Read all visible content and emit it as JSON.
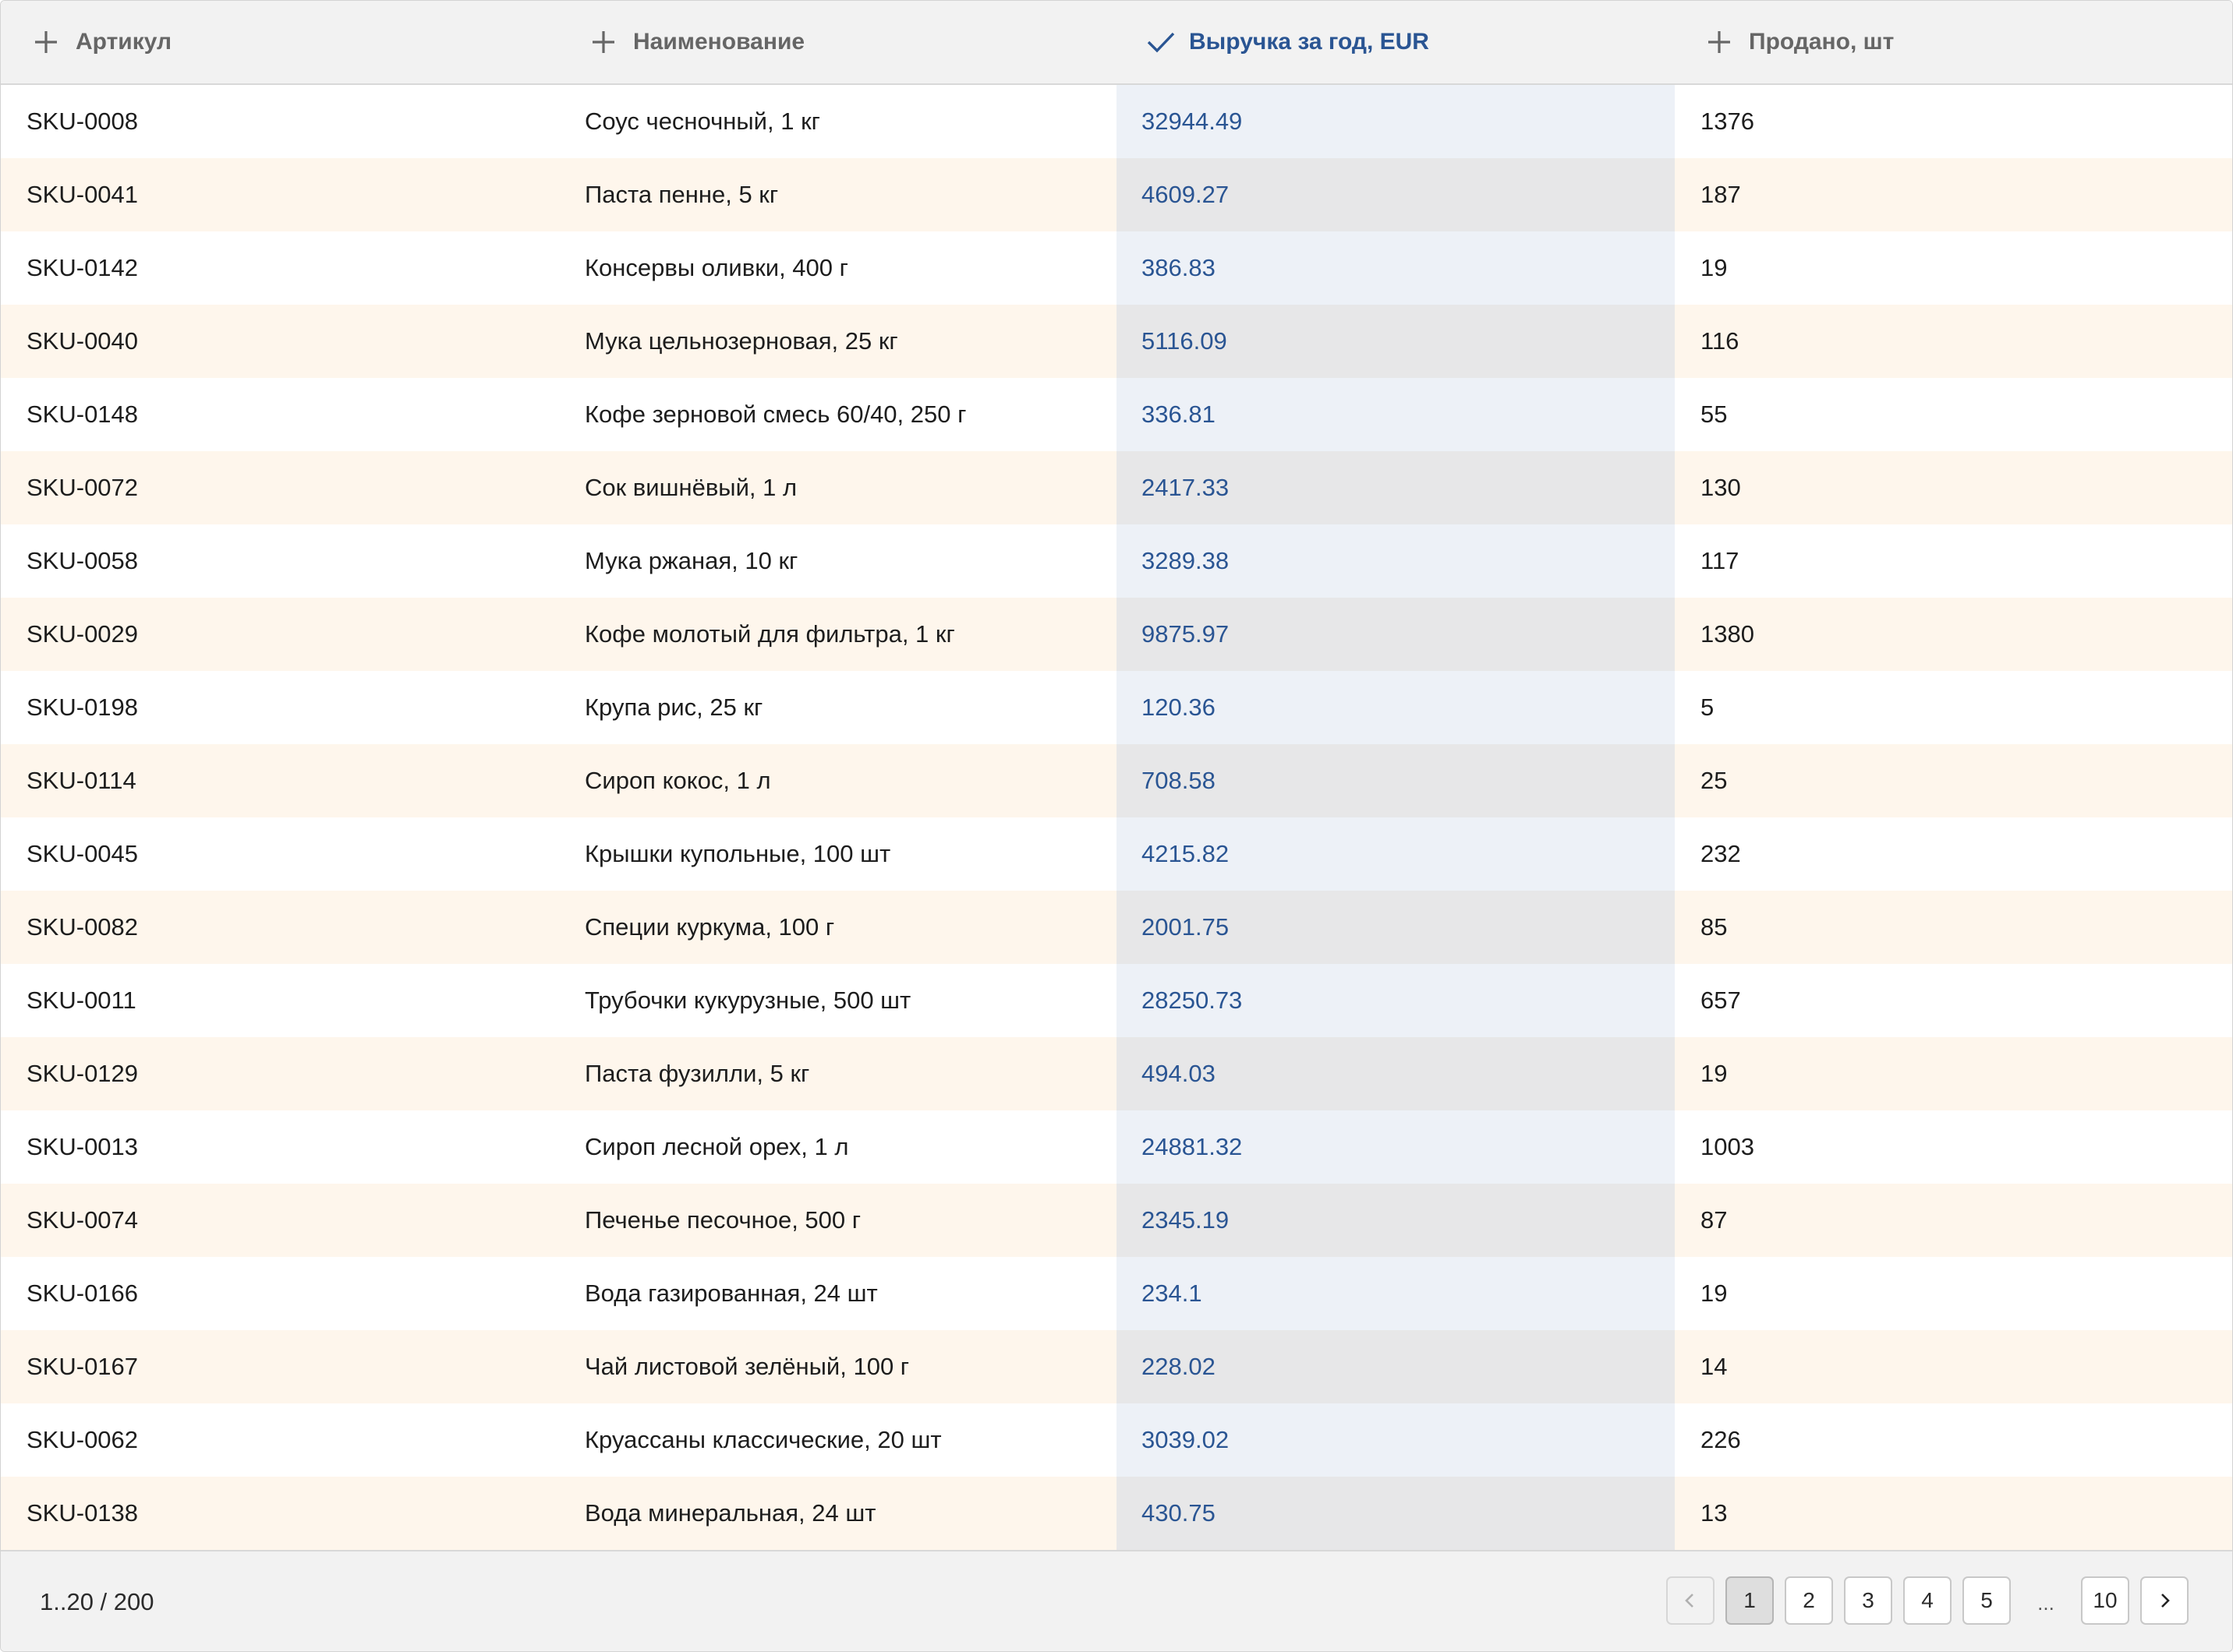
{
  "columns": [
    {
      "label": "Артикул",
      "icon": "plus-icon"
    },
    {
      "label": "Наименование",
      "icon": "plus-icon"
    },
    {
      "label": "Выручка за год, EUR",
      "icon": "check-icon",
      "active": true
    },
    {
      "label": "Продано, шт",
      "icon": "plus-icon"
    }
  ],
  "rows": [
    [
      "SKU-0008",
      "Соус чесночный, 1 кг",
      "32944.49",
      "1376"
    ],
    [
      "SKU-0041",
      "Паста пенне, 5 кг",
      "4609.27",
      "187"
    ],
    [
      "SKU-0142",
      "Консервы оливки, 400 г",
      "386.83",
      "19"
    ],
    [
      "SKU-0040",
      "Мука цельнозерновая, 25 кг",
      "5116.09",
      "116"
    ],
    [
      "SKU-0148",
      "Кофе зерновой смесь 60/40, 250 г",
      "336.81",
      "55"
    ],
    [
      "SKU-0072",
      "Сок вишнёвый, 1 л",
      "2417.33",
      "130"
    ],
    [
      "SKU-0058",
      "Мука ржаная, 10 кг",
      "3289.38",
      "117"
    ],
    [
      "SKU-0029",
      "Кофе молотый для фильтра, 1 кг",
      "9875.97",
      "1380"
    ],
    [
      "SKU-0198",
      "Крупа рис, 25 кг",
      "120.36",
      "5"
    ],
    [
      "SKU-0114",
      "Сироп кокос, 1 л",
      "708.58",
      "25"
    ],
    [
      "SKU-0045",
      "Крышки купольные, 100 шт",
      "4215.82",
      "232"
    ],
    [
      "SKU-0082",
      "Специи куркума, 100 г",
      "2001.75",
      "85"
    ],
    [
      "SKU-0011",
      "Трубочки кукурузные, 500 шт",
      "28250.73",
      "657"
    ],
    [
      "SKU-0129",
      "Паста фузилли, 5 кг",
      "494.03",
      "19"
    ],
    [
      "SKU-0013",
      "Сироп лесной орех, 1 л",
      "24881.32",
      "1003"
    ],
    [
      "SKU-0074",
      "Печенье песочное, 500 г",
      "2345.19",
      "87"
    ],
    [
      "SKU-0166",
      "Вода газированная, 24 шт",
      "234.1",
      "19"
    ],
    [
      "SKU-0167",
      "Чай листовой зелёный, 100 г",
      "228.02",
      "14"
    ],
    [
      "SKU-0062",
      "Круассаны классические, 20 шт",
      "3039.02",
      "226"
    ],
    [
      "SKU-0138",
      "Вода минеральная, 24 шт",
      "430.75",
      "13"
    ]
  ],
  "footer": {
    "range": "1..20 / 200",
    "prev_icon": "chevron-left-icon",
    "next_icon": "chevron-right-icon",
    "pages": [
      "1",
      "2",
      "3",
      "4",
      "5"
    ],
    "ellipsis": "...",
    "last_page": "10",
    "current_page": "1"
  },
  "colors": {
    "active_header": "#2a5593",
    "active_column_bg": "#edf1f7",
    "stripe": "#fef6ec"
  }
}
